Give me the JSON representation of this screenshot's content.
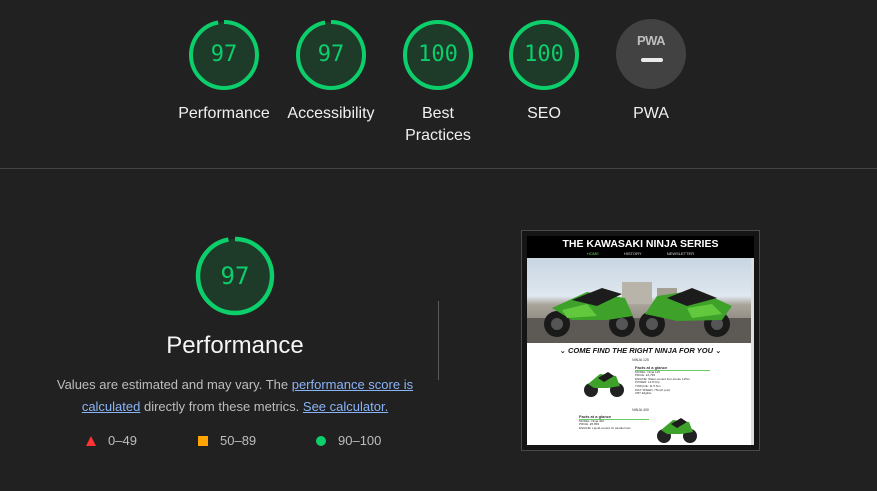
{
  "colors": {
    "pass": "#0cce6b",
    "average": "#ffa400",
    "fail": "#ff3333",
    "background": "#212121"
  },
  "scores": [
    {
      "label": "Performance",
      "value": "97",
      "score": 97
    },
    {
      "label": "Accessibility",
      "value": "97",
      "score": 97
    },
    {
      "label": "Best Practices",
      "value": "100",
      "score": 100
    },
    {
      "label": "SEO",
      "value": "100",
      "score": 100
    }
  ],
  "pwa": {
    "badge": "PWA",
    "label": "PWA"
  },
  "performance": {
    "score": "97",
    "score_value": 97,
    "title": "Performance",
    "desc_prefix": "Values are estimated and may vary. The ",
    "link_score": "performance score is calculated",
    "desc_middle": " directly from these metrics. ",
    "link_calc": "See calculator."
  },
  "legend": {
    "fail": "0–49",
    "average": "50–89",
    "pass": "90–100"
  },
  "screenshot": {
    "site_title": "THE KAWASAKI NINJA SERIES",
    "nav": [
      "HOME",
      "HISTORY",
      "NEWSLETTER"
    ],
    "banner": "COME FIND THE RIGHT NINJA FOR YOU",
    "models": [
      "NINJA 125",
      "NINJA 400"
    ],
    "facts_heading": "Facts at a glance",
    "facts_1": [
      "MODEL: Ninja 125",
      "PRICE: £4,799",
      "ENGINE: Water-cooled four-stroke 125cc",
      "POWER: 14.8 bhp",
      "TORQUE: 11.5 Nm",
      "MAX SPEED: 75mph (est)",
      "CBT Eligible"
    ],
    "facts_2": [
      "MODEL: Ninja 400",
      "PRICE: £5,899",
      "ENGINE: Liquid-cooled 4x parallel twin"
    ]
  }
}
